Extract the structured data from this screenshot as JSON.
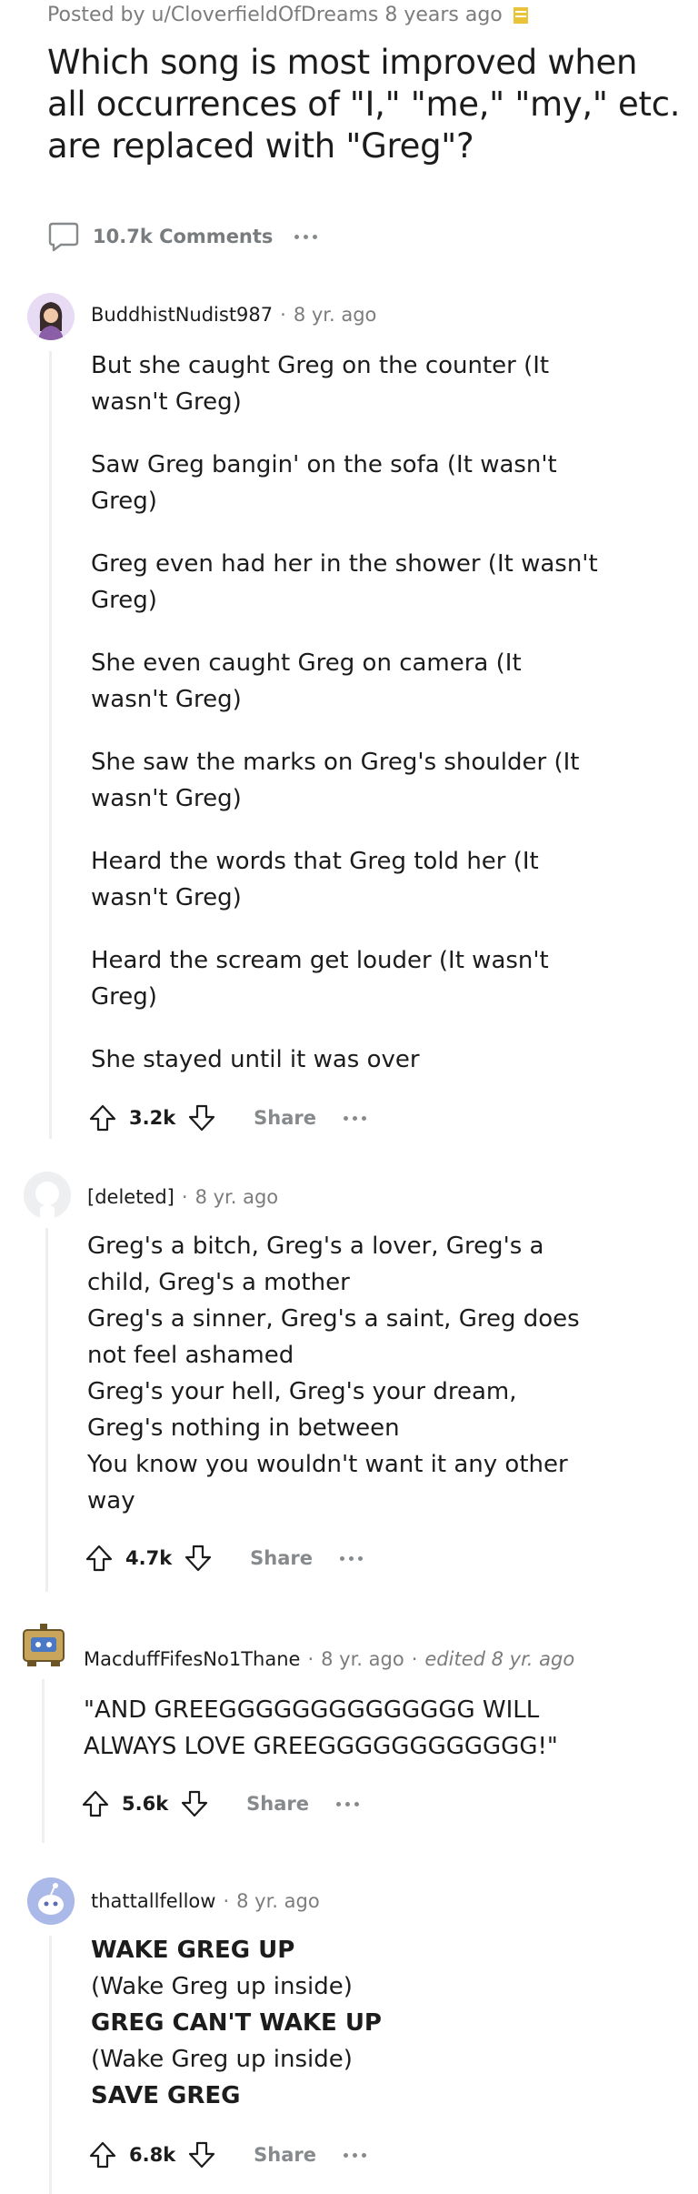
{
  "post": {
    "meta": "Posted by u/CloverfieldOfDreams 8 years ago",
    "title": "Which song is most improved when all occurrences of \"I,\" \"me,\" \"my,\" etc. are replaced with \"Greg\"?",
    "comments_label": "10.7k Comments"
  },
  "comments": [
    {
      "user": "BuddhistNudist987",
      "time": "8 yr. ago",
      "lines": [
        "But she caught Greg on the counter (It wasn't Greg)",
        "Saw Greg bangin' on the sofa (It wasn't Greg)",
        "Greg even had her in the shower (It wasn't Greg)",
        "She even caught Greg on camera (It wasn't Greg)",
        "She saw the marks on Greg's shoulder (It wasn't Greg)",
        "Heard the words that Greg told her (It wasn't Greg)",
        "Heard the scream get louder (It wasn't Greg)",
        "She stayed until it was over"
      ],
      "score": "3.2k",
      "share": "Share"
    },
    {
      "user": "[deleted]",
      "time": "8 yr. ago",
      "lines": [
        "Greg's a bitch, Greg's a lover, Greg's a child, Greg's a mother",
        "Greg's a sinner, Greg's a saint, Greg does not feel ashamed",
        "Greg's your hell, Greg's your dream, Greg's nothing in between",
        "You know you wouldn't want it any other way"
      ],
      "score": "4.7k",
      "share": "Share"
    },
    {
      "user": "MacduffFifesNo1Thane",
      "time": "8 yr. ago",
      "edited": "edited 8 yr. ago",
      "lines": [
        "\"AND GREEGGGGGGGGGGGGGG WILL ALWAYS LOVE GREEGGGGGGGGGGGG!\""
      ],
      "score": "5.6k",
      "share": "Share"
    },
    {
      "user": "thattallfellow",
      "time": "8 yr. ago",
      "lines": [
        "WAKE GREG UP",
        "(Wake Greg up inside)",
        "GREG CAN'T WAKE UP",
        "(Wake Greg up inside)",
        "SAVE GREG"
      ],
      "score": "6.8k",
      "share": "Share"
    }
  ],
  "icons": {
    "comment": "comment-bubble-icon",
    "upvote": "arrow-up-icon",
    "downvote": "arrow-down-icon",
    "more": "more-dots-icon",
    "award": "award-icon"
  },
  "colors": {
    "meta_text": "#7c7c7c",
    "thread_line": "#edeff1",
    "award": "#e9c43b"
  }
}
